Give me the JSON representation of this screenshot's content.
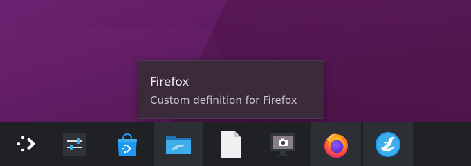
{
  "tooltip": {
    "title": "Firefox",
    "subtitle": "Custom definition for Firefox"
  },
  "taskbar": {
    "items": [
      {
        "icon": "application-launcher-icon",
        "active": false
      },
      {
        "icon": "system-settings-icon",
        "active": false
      },
      {
        "icon": "discover-store-icon",
        "active": false
      },
      {
        "icon": "dolphin-file-manager-icon",
        "active": true
      },
      {
        "icon": "text-document-icon",
        "active": false
      },
      {
        "icon": "spectacle-screenshot-icon",
        "active": false
      },
      {
        "icon": "firefox-icon",
        "active": true
      },
      {
        "icon": "kde-app-icon",
        "active": true
      }
    ]
  },
  "colors": {
    "wallpaper": "#5f1c62",
    "panel": "#1f2124",
    "tooltip_bg": "#3a2a3b",
    "folder_blue": "#3daee9",
    "firefox_orange": "#ff7139"
  }
}
